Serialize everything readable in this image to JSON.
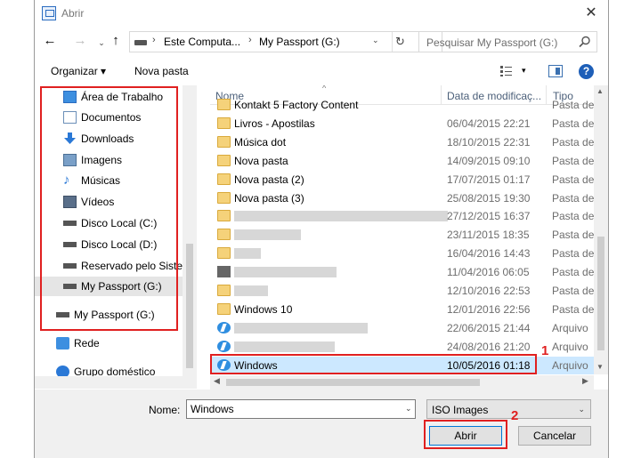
{
  "window": {
    "title": "Abrir",
    "close_glyph": "✕"
  },
  "nav": {
    "back": "←",
    "forward": "→",
    "up": "↑"
  },
  "address": {
    "segments": [
      "Este Computa...",
      "My Passport (G:)"
    ],
    "sep": "›",
    "dropdown": "⌄",
    "refresh": "↻"
  },
  "search": {
    "placeholder": "Pesquisar My Passport (G:)"
  },
  "toolbar": {
    "organize": "Organizar ▾",
    "new_folder": "Nova pasta",
    "view_dd": "▾",
    "help": "?"
  },
  "sidebar": {
    "items": [
      {
        "label": "Área de Trabalho",
        "icon": "desktop-icon"
      },
      {
        "label": "Documentos",
        "icon": "documents-icon"
      },
      {
        "label": "Downloads",
        "icon": "downloads-icon"
      },
      {
        "label": "Imagens",
        "icon": "pictures-icon"
      },
      {
        "label": "Músicas",
        "icon": "music-icon"
      },
      {
        "label": "Vídeos",
        "icon": "videos-icon"
      },
      {
        "label": "Disco Local (C:)",
        "icon": "drive-icon"
      },
      {
        "label": "Disco Local (D:)",
        "icon": "drive-icon"
      },
      {
        "label": "Reservado pelo Sisten",
        "icon": "drive-icon"
      },
      {
        "label": "My Passport (G:)",
        "icon": "drive-icon",
        "selected": true
      }
    ],
    "extra": [
      {
        "label": "My Passport (G:)",
        "icon": "drive-icon"
      },
      {
        "label": "Rede",
        "icon": "network-icon"
      },
      {
        "label": "Grupo doméstico",
        "icon": "homegroup-icon"
      }
    ]
  },
  "columns": {
    "name": "Nome",
    "date": "Data de modificaç...",
    "type": "Tipo",
    "sort_caret": "^"
  },
  "files": [
    {
      "name": "Kontakt 5 Factory Content",
      "date": "",
      "type": "Pasta de",
      "icon": "folder-icon"
    },
    {
      "name": "Livros - Apostilas",
      "date": "06/04/2015 22:21",
      "type": "Pasta de",
      "icon": "folder-icon"
    },
    {
      "name": "Música dot",
      "date": "18/10/2015 22:31",
      "type": "Pasta de",
      "icon": "folder-icon"
    },
    {
      "name": "Nova pasta",
      "date": "14/09/2015 09:10",
      "type": "Pasta de",
      "icon": "folder-icon"
    },
    {
      "name": "Nova pasta (2)",
      "date": "17/07/2015 01:17",
      "type": "Pasta de",
      "icon": "folder-icon"
    },
    {
      "name": "Nova pasta (3)",
      "date": "25/08/2015 19:30",
      "type": "Pasta de",
      "icon": "folder-icon"
    },
    {
      "name": "",
      "date": "27/12/2015 16:37",
      "type": "Pasta de",
      "icon": "folder-icon",
      "blurred": 240
    },
    {
      "name": "",
      "date": "23/11/2015 18:35",
      "type": "Pasta de",
      "icon": "folder-icon",
      "blurred": 75
    },
    {
      "name": "",
      "date": "16/04/2016 14:43",
      "type": "Pasta de",
      "icon": "folder-icon",
      "blurred": 30
    },
    {
      "name": "",
      "date": "11/04/2016 06:05",
      "type": "Pasta de",
      "icon": "exe-icon",
      "blurred": 115
    },
    {
      "name": "",
      "date": "12/10/2016 22:53",
      "type": "Pasta de",
      "icon": "folder-icon",
      "blurred": 38
    },
    {
      "name": "Windows 10",
      "date": "12/01/2016 22:56",
      "type": "Pasta de",
      "icon": "folder-icon"
    },
    {
      "name": "",
      "date": "22/06/2015 21:44",
      "type": "Arquivo",
      "icon": "iso-icon",
      "blurred": 150
    },
    {
      "name": "",
      "date": "24/08/2016 21:20",
      "type": "Arquivo",
      "icon": "iso-icon",
      "blurred": 113
    },
    {
      "name": "Windows",
      "date": "10/05/2016 01:18",
      "type": "Arquivo",
      "icon": "iso-icon",
      "selected": true
    }
  ],
  "bottom": {
    "name_label": "Nome:",
    "name_value": "Windows",
    "filetype": "ISO Images",
    "open": "Abrir",
    "cancel": "Cancelar",
    "dd": "⌄"
  },
  "annotations": {
    "one": "1",
    "two": "2"
  },
  "colors": {
    "accent": "#0078d7",
    "annotation": "#e02020",
    "selection": "#cce8ff"
  }
}
